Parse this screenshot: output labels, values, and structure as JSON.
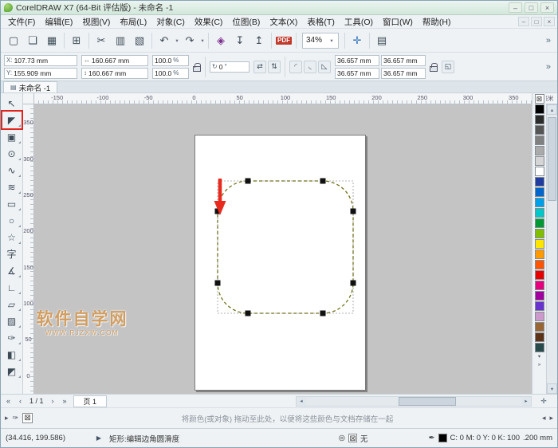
{
  "window": {
    "title": "CorelDRAW X7 (64-Bit 评估版) - 未命名 -1",
    "minimize_glyph": "–",
    "maximize_glyph": "□",
    "close_glyph": "×"
  },
  "menu": {
    "items": [
      "文件(F)",
      "编辑(E)",
      "视图(V)",
      "布局(L)",
      "对象(C)",
      "效果(C)",
      "位图(B)",
      "文本(X)",
      "表格(T)",
      "工具(O)",
      "窗口(W)",
      "帮助(H)"
    ],
    "doc_minimize_glyph": "–",
    "doc_restore_glyph": "□",
    "doc_close_glyph": "×"
  },
  "toolbar": {
    "new_glyph": "▢",
    "open_glyph": "❏",
    "save_glyph": "▦",
    "print_glyph": "⊞",
    "cut_glyph": "✂",
    "copy_glyph": "▥",
    "paste_glyph": "▧",
    "undo_glyph": "↶",
    "redo_glyph": "↷",
    "dropdown_glyph": "▾",
    "search_glyph": "◈",
    "import_glyph": "↧",
    "export_glyph": "↥",
    "pdf_label": "PDF",
    "zoom_value": "34%",
    "pan_glyph": "✛",
    "window_glyph": "▤",
    "overflow_glyph": "»"
  },
  "property_bar": {
    "x_label": "X:",
    "x_value": "107.73 mm",
    "y_label": "Y:",
    "y_value": "155.909 mm",
    "width_icon": "↔",
    "width_value": "160.667 mm",
    "height_icon": "↕",
    "height_value": "160.667 mm",
    "scale_h_value": "100.0",
    "scale_v_value": "100.0",
    "percent": "%",
    "rotate_icon": "↻",
    "rotation_value": "0",
    "degree": "°",
    "mirror_h_glyph": "⇄",
    "mirror_v_glyph": "⇅",
    "corner_round_glyph": "◜",
    "corner_scallop_glyph": "◟",
    "corner_chamfer_glyph": "◺",
    "corner_tl": "36.657 mm",
    "corner_tr": "36.657 mm",
    "corner_bl": "36.657 mm",
    "corner_br": "36.657 mm",
    "relative_corner_glyph": "◱",
    "overflow_glyph": "»"
  },
  "tab_bar": {
    "doc_icon_glyph": "▤",
    "active_tab": "未命名 -1"
  },
  "rulers": {
    "h_ticks": [
      "-150",
      "-100",
      "-50",
      "0",
      "50",
      "100",
      "150",
      "200",
      "250",
      "300",
      "350"
    ],
    "v_ticks": [
      "350",
      "300",
      "250",
      "200",
      "150",
      "100",
      "50",
      "0"
    ],
    "unit": "毫米"
  },
  "toolbox": {
    "tools": [
      {
        "label": "选择工具",
        "glyph": "↖"
      },
      {
        "label": "形状工具",
        "glyph": "◤"
      },
      {
        "label": "裁剪工具",
        "glyph": "▣"
      },
      {
        "label": "缩放工具",
        "glyph": "⊙"
      },
      {
        "label": "手绘工具",
        "glyph": "∿"
      },
      {
        "label": "艺术笔工具",
        "glyph": "≋"
      },
      {
        "label": "矩形工具",
        "glyph": "▭"
      },
      {
        "label": "椭圆形工具",
        "glyph": "○"
      },
      {
        "label": "多边形工具",
        "glyph": "☆"
      },
      {
        "label": "文本工具",
        "glyph": "字"
      },
      {
        "label": "度量工具",
        "glyph": "∡"
      },
      {
        "label": "连接器工具",
        "glyph": "∟"
      },
      {
        "label": "阴影工具",
        "glyph": "▱"
      },
      {
        "label": "透明度工具",
        "glyph": "▨"
      },
      {
        "label": "颜色滴管工具",
        "glyph": "✑"
      },
      {
        "label": "交互式填充工具",
        "glyph": "◧"
      },
      {
        "label": "智能填充工具",
        "glyph": "◩"
      }
    ]
  },
  "palette": {
    "none_glyph": "⊠",
    "colors": [
      "#000000",
      "#2B2B2B",
      "#555555",
      "#808080",
      "#AAAAAA",
      "#D5D5D5",
      "#FFFFFF",
      "#1F3C9E",
      "#0066CC",
      "#00A0E9",
      "#00C8C8",
      "#009933",
      "#7FBF00",
      "#FFE600",
      "#FF9900",
      "#FF5500",
      "#E60000",
      "#E6007E",
      "#A0009E",
      "#6633CC",
      "#CC99CC",
      "#996633",
      "#5C3317",
      "#284A4A"
    ],
    "scroll_glyph": "▾",
    "flyout_glyph": "»"
  },
  "canvas": {
    "watermark_title": "软件自学网",
    "watermark_url": "WWW.RJZXW.COM"
  },
  "page_nav": {
    "first_glyph": "«",
    "prev_glyph": "‹",
    "label": "1 / 1",
    "next_glyph": "›",
    "last_glyph": "»",
    "page_tab": "页 1",
    "navigator_glyph": "✛"
  },
  "scrollbars": {
    "up": "▴",
    "down": "▾",
    "left": "◂",
    "right": "▸"
  },
  "document_palette": {
    "flyout_glyph": "▸",
    "eyedropper_glyph": "✑",
    "none_glyph": "⊠",
    "hint": "将颜色(或对象) 拖动至此处，以便将这些颜色与文档存储在一起",
    "left_glyph": "◂",
    "right_glyph": "▸"
  },
  "status_bar": {
    "coords": "(34.416, 199.586)",
    "expand_glyph": "▶",
    "message": "矩形:编辑边角圆滑度",
    "fill_icon_glyph": "◎",
    "fill_none_glyph": "⊠",
    "fill_none_label": "无",
    "outline_pen_glyph": "✒",
    "outline_swatch_color": "#000000",
    "outline_color_label": "C: 0 M: 0 Y: 0 K: 100",
    "outline_width": ".200 mm"
  }
}
